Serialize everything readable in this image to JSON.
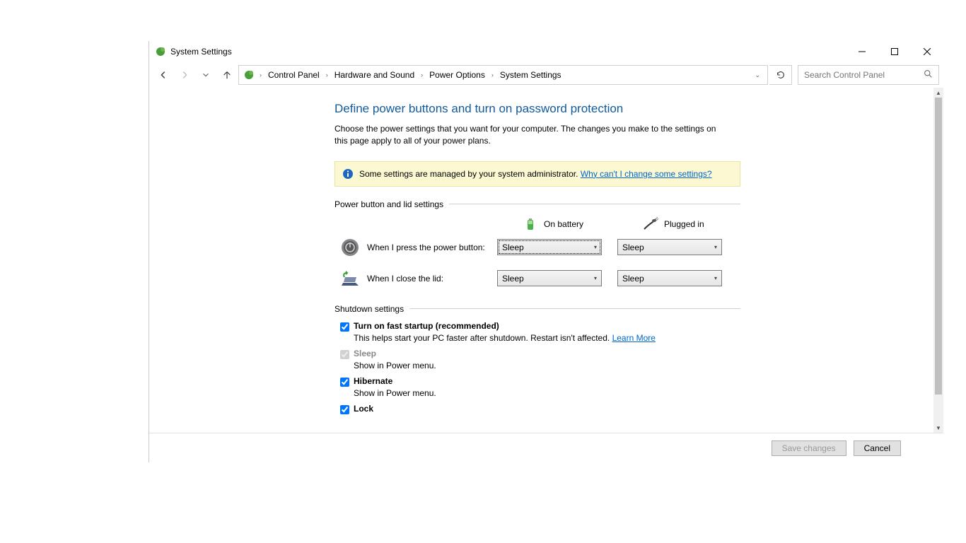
{
  "window": {
    "title": "System Settings"
  },
  "breadcrumb": {
    "items": [
      "Control Panel",
      "Hardware and Sound",
      "Power Options",
      "System Settings"
    ]
  },
  "search": {
    "placeholder": "Search Control Panel"
  },
  "page": {
    "heading": "Define power buttons and turn on password protection",
    "intro": "Choose the power settings that you want for your computer. The changes you make to the settings on this page apply to all of your power plans."
  },
  "notice": {
    "text": "Some settings are managed by your system administrator.",
    "link": "Why can't I change some settings?"
  },
  "power_section": {
    "title": "Power button and lid settings",
    "col_battery": "On battery",
    "col_plugged": "Plugged in",
    "row_power": "When I press the power button:",
    "row_lid": "When I close the lid:",
    "val_power_batt": "Sleep",
    "val_power_ac": "Sleep",
    "val_lid_batt": "Sleep",
    "val_lid_ac": "Sleep"
  },
  "shutdown_section": {
    "title": "Shutdown settings",
    "fast_startup": "Turn on fast startup (recommended)",
    "fast_startup_sub": "This helps start your PC faster after shutdown. Restart isn't affected.",
    "learn_more": "Learn More",
    "sleep": "Sleep",
    "sleep_sub": "Show in Power menu.",
    "hibernate": "Hibernate",
    "hibernate_sub": "Show in Power menu.",
    "lock": "Lock"
  },
  "footer": {
    "save": "Save changes",
    "cancel": "Cancel"
  }
}
